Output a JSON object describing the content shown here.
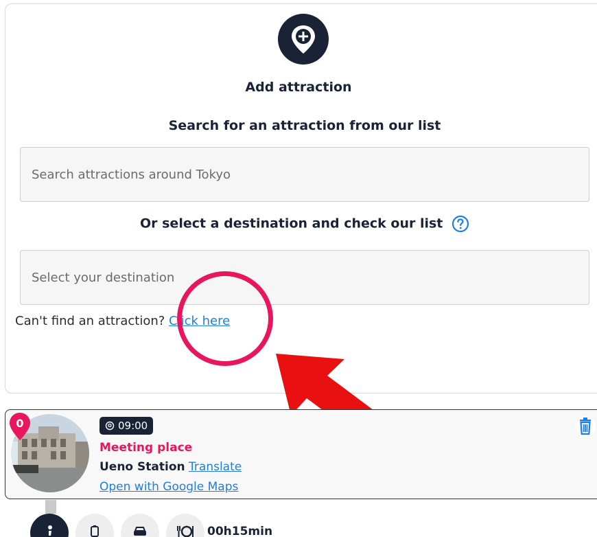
{
  "add_attraction": {
    "title": "Add attraction",
    "search_heading": "Search for an attraction from our list",
    "search_placeholder": "Search attractions around Tokyo",
    "or_heading": "Or select a destination and check our list",
    "destination_placeholder": "Select your destination",
    "cant_find_text": "Can't find an attraction? ",
    "click_here_link": "Click here",
    "icons": {
      "add": "add-location-icon",
      "help": "help-circle-icon"
    }
  },
  "stop": {
    "index": "0",
    "time": "09:00",
    "type_label": "Meeting place",
    "location_name": "Ueno Station",
    "translate_link": "Translate",
    "maps_link": "Open with Google Maps",
    "icons": {
      "time": "location-pin-icon",
      "delete": "trash-icon"
    }
  },
  "transport": {
    "modes": [
      "walk-icon",
      "transit-icon",
      "car-icon",
      "meal-icon"
    ],
    "active_mode": "walk-icon",
    "duration": "00h15min"
  },
  "annotation": {
    "highlight_color": "#e8175d",
    "arrow_color": "#e81010"
  },
  "colors": {
    "navy": "#1a2235",
    "accent_pink": "#e8175d",
    "link_blue": "#1f7ee0"
  }
}
